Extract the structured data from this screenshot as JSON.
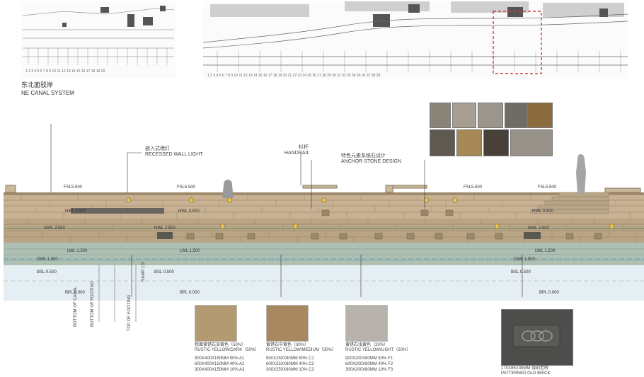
{
  "section": {
    "title_cn": "东北面驳岸",
    "title_en": "NE CANAL SYSTEM"
  },
  "callouts": [
    {
      "id": "lamp",
      "cn": "嵌入式墙灯",
      "en": "RECESSED WALL LIGHT"
    },
    {
      "id": "rail",
      "cn": "栏杆",
      "en": "HANDRAIL"
    },
    {
      "id": "anchor",
      "cn": "特色元素系统石设计",
      "en": "ANCHOR STONE DESIGN"
    }
  ],
  "levels_top": [
    "FSL5.500",
    "FSL5.500",
    "FSL5.500",
    "FSL5.500"
  ],
  "levels_mid1": [
    "HWL 3.500",
    "HWL 3.500",
    "HWL 3.500"
  ],
  "levels_mid2": [
    "NWL 2.500",
    "NWL 2.500",
    "NWL 2.500"
  ],
  "levels_mid3": [
    "LWL 1.500",
    "LWL 1.500",
    "LWL 1.500"
  ],
  "levels_mid4": [
    "DWL 1.000",
    "DWL 1.000"
  ],
  "levels_bsl": [
    "BSL 0.500",
    "BSL 0.500",
    "BSL 0.500"
  ],
  "levels_bpl": [
    "BPL 0.000",
    "BPL 0.000",
    "BPL 0.000"
  ],
  "vertical_labels": [
    "BOTTOM OF CANAL",
    "BOTTOM OF FOOTING",
    "TOP OF FOOTING",
    "RAMP 1:5"
  ],
  "materials": [
    {
      "id": "a",
      "cn": "粗面黄锈石深黄色（50%）",
      "en": "RUSTIC YELLOW/DARK（50%）",
      "sizes": [
        "900X400X150MM 50% A1",
        "600X400X150MM 40% A2",
        "300X400X150MM 10% A3"
      ],
      "color": "#b39a72"
    },
    {
      "id": "c",
      "cn": "黄锈石中黄色（30%）",
      "en": "RUSTIC YELLOW/MEDIUM（30%）",
      "sizes": [
        "900X250X80MM 50% C1",
        "600X250X80MM 40% C2",
        "300X250X80MM 10% C3"
      ],
      "color": "#a8885e"
    },
    {
      "id": "f",
      "cn": "黄锈石浅黄色（20%）",
      "en": "RUSTIC YELLOW/LIGHT（20%）",
      "sizes": [
        "900X200X80MM 50% F1",
        "600X200X80MM 40% F2",
        "300X200X80MM 10% F3"
      ],
      "color": "#b7b2ab"
    }
  ],
  "brick": {
    "size": "170X85X35MM 蚀刻老砖",
    "label": "PATTERNED OLD BRICK"
  },
  "colors": {
    "wall": "#c9b396",
    "wall_dark": "#a38c6c",
    "band": "#a9bcaf",
    "water": "#dfe9ef",
    "accent": "#d23a3a"
  }
}
